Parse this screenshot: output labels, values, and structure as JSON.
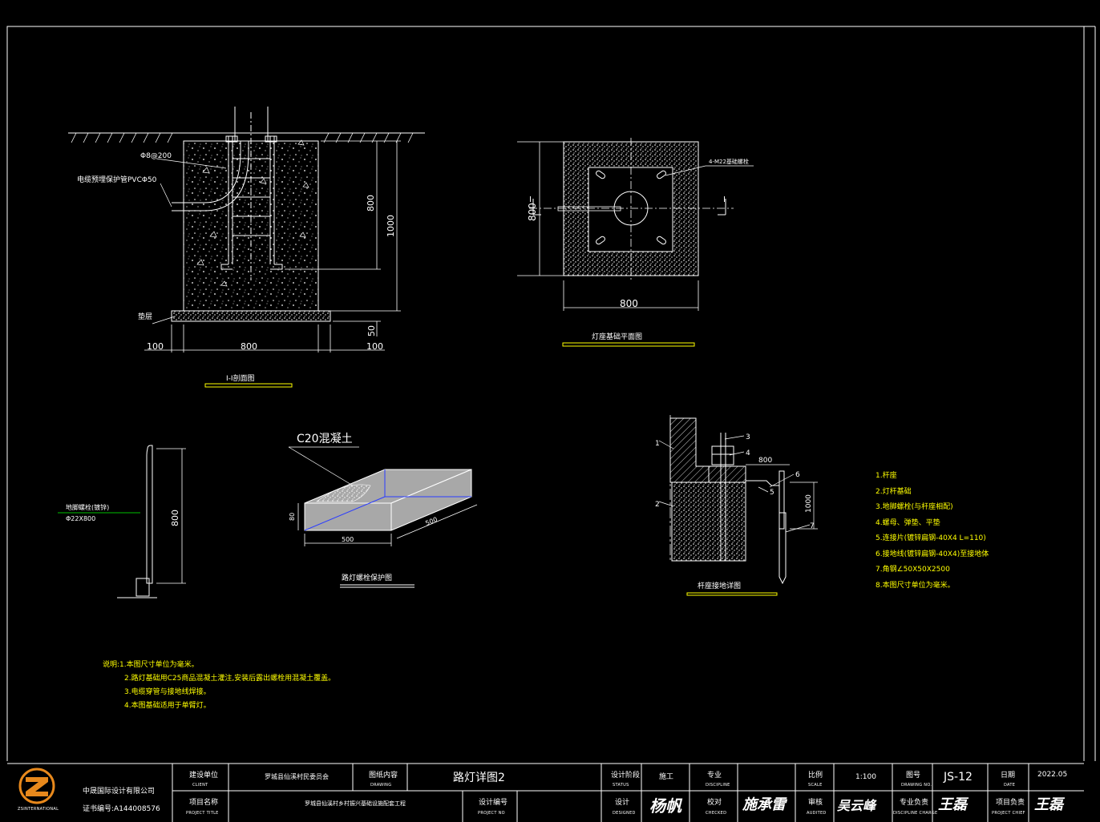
{
  "sections": {
    "section_1_1": {
      "title": "I-I剖面图",
      "dims": {
        "left_offset": "100",
        "width": "800",
        "right_offset": "100",
        "depth_800": "800",
        "depth_1000": "1000",
        "base_50": "50"
      },
      "labels": {
        "rebar": "Φ8@200",
        "conduit": "电缆预埋保护管PVCΦ50",
        "cushion": "垫层"
      }
    },
    "plan": {
      "title": "灯座基础平面图",
      "dims": {
        "height": "800",
        "width": "800"
      },
      "labels": {
        "anchor": "4-M22基础螺栓",
        "cut_left": "I",
        "cut_right": "I"
      }
    },
    "bolt": {
      "label": "地脚螺栓(镀锌)",
      "spec": "Φ22X800",
      "dim": "800"
    },
    "protection": {
      "title": "路灯螺栓保护图",
      "concrete": "C20混凝土",
      "dim_height": "80",
      "dim_width": "500",
      "dim_depth": "500"
    },
    "grounding": {
      "title": "杆座接地详图",
      "callouts": [
        "1",
        "2",
        "3",
        "4",
        "5",
        "6",
        "7"
      ],
      "dims": {
        "width": "800",
        "height": "1000"
      }
    }
  },
  "legend": [
    "1.杆座",
    "2.灯杆基础",
    "3.地脚螺栓(与杆座相配)",
    "4.螺母、弹垫、平垫",
    "5.连接片(镀锌扁钢-40X4  L=110)",
    "6.接地线(镀锌扁钢-40X4)至接地体",
    "7.角钢∠50X50X2500",
    "8.本图尺寸单位为毫米。"
  ],
  "notes": [
    "说明:1.本图尺寸单位为毫米。",
    "2.路灯基础用C25商品混凝土灌注,安装后露出螺栓用混凝土覆盖。",
    "3.电缆穿管与接地线焊接。",
    "4.本图基础适用于单臂灯。"
  ],
  "title_block": {
    "company_name": "中晟国际设计有限公司",
    "company_cert": "证书编号:A144008576",
    "logo_caption": "ZSINTERNATIONAL",
    "client_label": "建设单位",
    "client_sub": "CLIENT",
    "client_value": "罗城县仙溪村民委员会",
    "project_label": "项目名称",
    "project_sub": "PROJECT TITLE",
    "project_value": "罗城县仙溪村乡村振兴基础设施配套工程",
    "drawing_label": "图纸内容",
    "drawing_sub": "DRAWING",
    "drawing_value": "路灯详图2",
    "project_no_label": "设计编号",
    "project_no_sub": "PROJECT NO",
    "status_label": "设计阶段",
    "status_sub": "STATUS",
    "status_value": "施工",
    "discipline_label": "专业",
    "discipline_sub": "DISCIPLINE",
    "designed_label": "设计",
    "designed_sub": "DESIGNED",
    "checked_label": "校对",
    "checked_sub": "CHECKED",
    "scale_label": "比例",
    "scale_sub": "SCALE",
    "scale_value": "1:100",
    "audited_label": "审核",
    "audited_sub": "AUDITED",
    "drawing_no_label": "图号",
    "drawing_no_sub": "DRAWING NO.",
    "drawing_no_value": "JS-12",
    "discipline_charge_label": "专业负责",
    "discipline_charge_sub": "DISCIPLINE CHARGE",
    "date_label": "日期",
    "date_sub": "DATE",
    "date_value": "2022.05",
    "chief_label": "项目负责",
    "chief_sub": "PROJECT CHIEF",
    "sig_designer": "杨帆",
    "sig_checker": "施承雷",
    "sig_auditor": "吴云峰",
    "sig_discipline": "王磊",
    "sig_chief": "王磊"
  },
  "colors": {
    "background": "#000000",
    "line": "#ffffff",
    "note": "#ffff00",
    "accent_blue": "#2a3cff",
    "accent_green": "#00c000",
    "hatch": "#b0b0b0"
  }
}
